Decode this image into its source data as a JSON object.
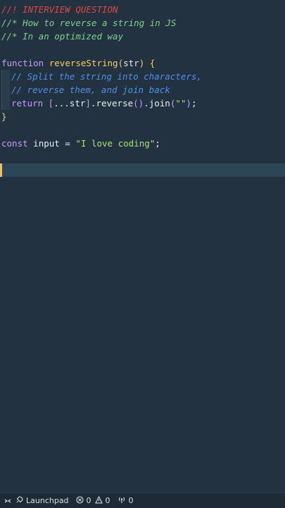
{
  "editor": {
    "lines": {
      "l1": "//! INTERVIEW QUESTION",
      "l2": "//* How to reverse a string in JS",
      "l3": "//* In an optimized way",
      "fn_kw": "function",
      "fn_name": "reverseString",
      "fn_open": "(",
      "fn_param": "str",
      "fn_close": ")",
      "fn_brace": " {",
      "c1": "// Split the string into characters,",
      "c2": "// reverse them, and join back",
      "ret_kw": "return",
      "ret_open_br": " [",
      "ret_spread": "...",
      "ret_str": "str",
      "ret_close_br": "]",
      "ret_dot1": ".",
      "ret_reverse": "reverse",
      "ret_rev_parens": "()",
      "ret_dot2": ".",
      "ret_join": "join",
      "ret_join_open": "(",
      "ret_join_arg": "\"\"",
      "ret_join_close": ")",
      "ret_semi": ";",
      "close_brace": "}",
      "const_kw": "const",
      "const_name": " input ",
      "const_eq": "=",
      "const_val": " \"I love coding\"",
      "const_semi": ";"
    }
  },
  "statusbar": {
    "launchpad_label": "Launchpad",
    "errors_count": "0",
    "warnings_count": "0",
    "ports_count": "0",
    "icons": {
      "remote": "remote-icon",
      "launchpad": "rocket-icon",
      "errors": "error-icon",
      "warnings": "warning-icon",
      "ports": "broadcast-icon"
    }
  },
  "colors": {
    "background": "#233240",
    "current_line": "#2c4657",
    "cursor": "#e8c170",
    "comment_alert": "#e0463e",
    "comment_star": "#7fd18a",
    "comment_plain": "#4f8fe8",
    "keyword": "#c69cff",
    "function": "#f2cf6b",
    "string": "#a9e36f"
  }
}
